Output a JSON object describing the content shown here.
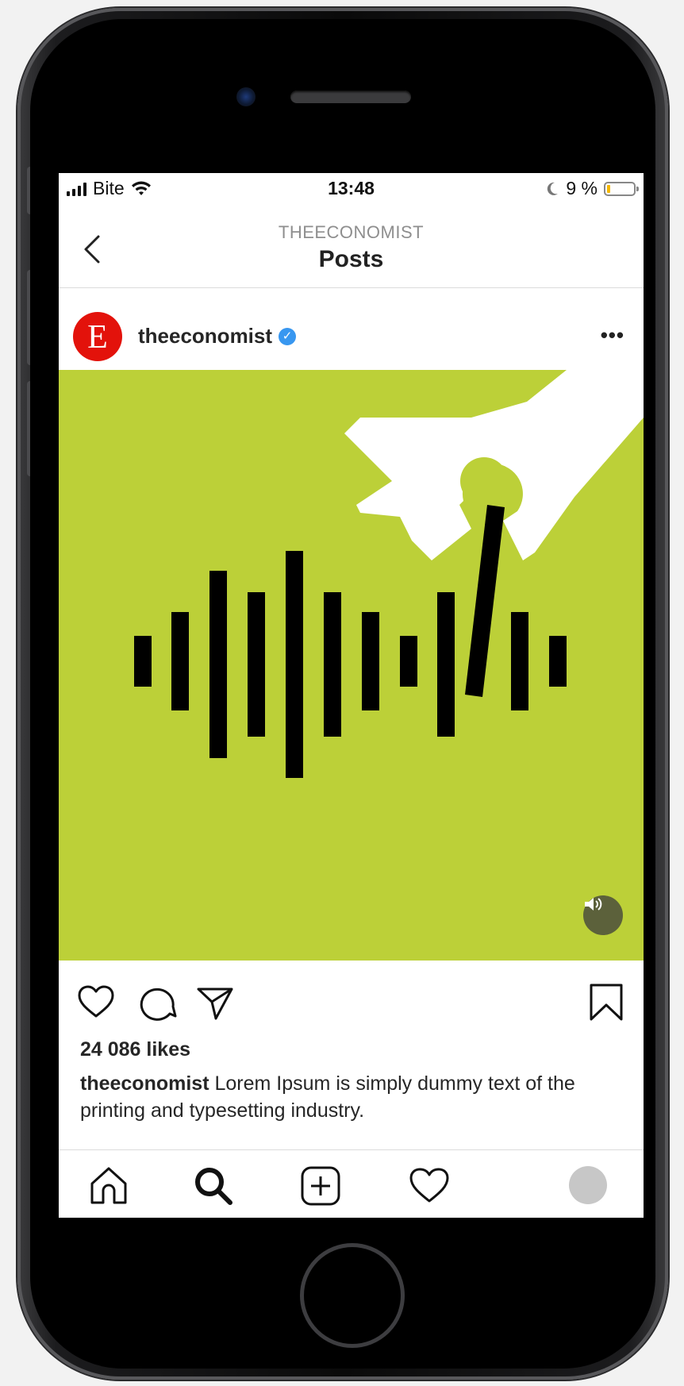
{
  "status_bar": {
    "carrier": "Bite",
    "time": "13:48",
    "battery_percent": "9 %"
  },
  "nav": {
    "account": "THEECONOMIST",
    "title": "Posts"
  },
  "post": {
    "username": "theeconomist",
    "logo_letter": "E",
    "likes": "24 086 likes",
    "caption_user": "theeconomist",
    "caption_text": "Lorem Ipsum is simply dummy text of the printing and typesetting industry."
  },
  "icons": {
    "back": "chevron-left-icon",
    "more": "more-horizontal-icon",
    "like": "heart-icon",
    "comment": "comment-icon",
    "share": "paper-plane-icon",
    "save": "bookmark-icon",
    "sound": "speaker-icon",
    "home": "home-icon",
    "search": "search-icon",
    "new_post": "plus-square-icon",
    "activity": "heart-icon",
    "profile": "avatar"
  },
  "colors": {
    "media_background": "#bcd038",
    "brand_red": "#e3120b",
    "verified_blue": "#3897f0",
    "battery_level": "#f5b800"
  }
}
